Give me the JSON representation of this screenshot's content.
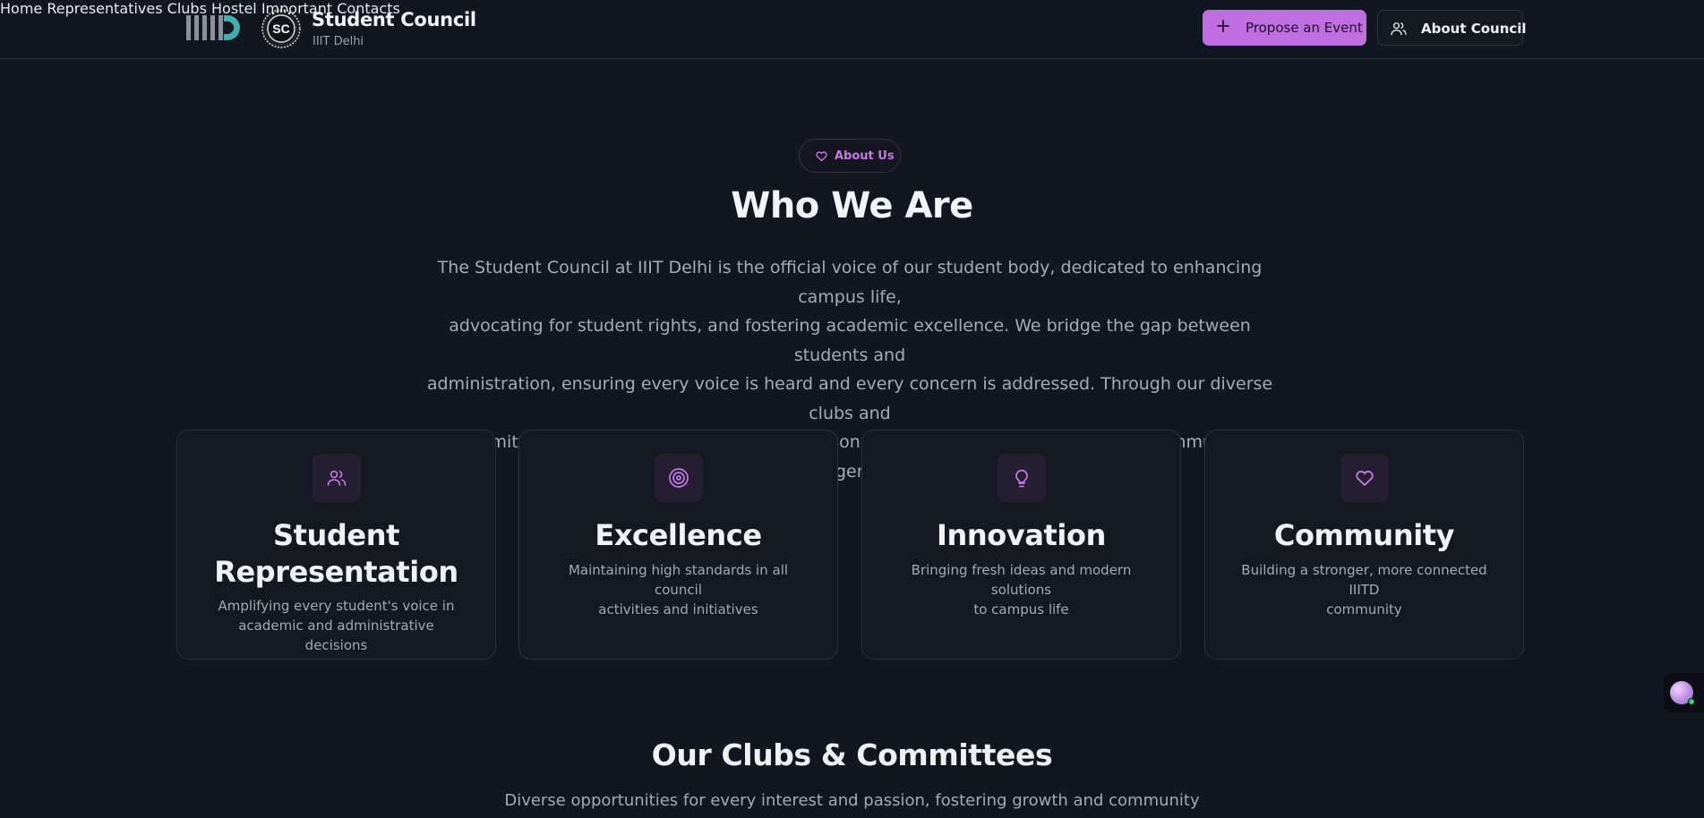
{
  "header": {
    "brand_title": "Student Council",
    "brand_subtitle": "IIIT Delhi",
    "sc_logo_text": "SC",
    "nav": [
      {
        "label": "Home"
      },
      {
        "label": "Representatives"
      },
      {
        "label": "Clubs"
      },
      {
        "label": "Hostel"
      },
      {
        "label": "Important Contacts"
      }
    ],
    "propose_label": "Propose an Event",
    "about_label": "About Council"
  },
  "about": {
    "pill_label": "About Us",
    "title": "Who We Are",
    "paragraph_lines": [
      "The Student Council at IIIT Delhi is the official voice of our student body, dedicated to enhancing campus life,",
      "advocating for student rights, and fostering academic excellence. We bridge the gap between students and",
      "administration, ensuring every voice is heard and every concern is addressed. Through our diverse clubs and",
      "committees, we create opportunities for personal growth, skill development, and community engagement."
    ]
  },
  "values": [
    {
      "icon": "users-icon",
      "title_lines": [
        "Student",
        "Representation"
      ],
      "desc_lines": [
        "Amplifying every student's voice in",
        "academic and administrative decisions"
      ]
    },
    {
      "icon": "target-icon",
      "title_lines": [
        "Excellence"
      ],
      "desc_lines": [
        "Maintaining high standards in all council",
        "activities and initiatives"
      ]
    },
    {
      "icon": "lightbulb-icon",
      "title_lines": [
        "Innovation"
      ],
      "desc_lines": [
        "Bringing fresh ideas and modern solutions",
        "to campus life"
      ]
    },
    {
      "icon": "heart-icon",
      "title_lines": [
        "Community"
      ],
      "desc_lines": [
        "Building a stronger, more connected IIITD",
        "community"
      ]
    }
  ],
  "clubs": {
    "title": "Our Clubs & Committees",
    "subtitle": "Diverse opportunities for every interest and passion, fostering growth and community"
  },
  "colors": {
    "background": "#121620",
    "accent": "#c06de0",
    "accent_text": "#c77ae8",
    "card_border": "#2c313c",
    "iiitd_teal": "#3fb0ac"
  }
}
